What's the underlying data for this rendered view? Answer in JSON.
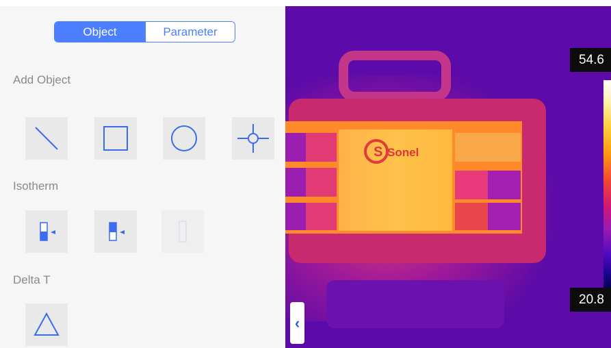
{
  "tabs": {
    "object_label": "Object",
    "parameter_label": "Parameter",
    "active": "Object"
  },
  "sections": {
    "add_object": "Add Object",
    "isotherm": "Isotherm",
    "delta_t": "Delta T"
  },
  "tools": {
    "add_object": [
      "line-tool-icon",
      "rectangle-tool-icon",
      "circle-tool-icon",
      "spot-tool-icon"
    ],
    "isotherm": [
      "isotherm-below-icon",
      "isotherm-above-icon",
      "isotherm-interval-icon"
    ],
    "delta_t": [
      "delta-triangle-icon"
    ]
  },
  "thermal": {
    "max_temp": "54.6",
    "min_temp": "20.8",
    "brand_text": "Sonel"
  },
  "collapse_glyph": "‹",
  "colors": {
    "accent": "#4c7fff",
    "panel_bg": "#f6f6f6",
    "tool_bg": "#e9e9e9",
    "icon": "#3a6cf0"
  }
}
